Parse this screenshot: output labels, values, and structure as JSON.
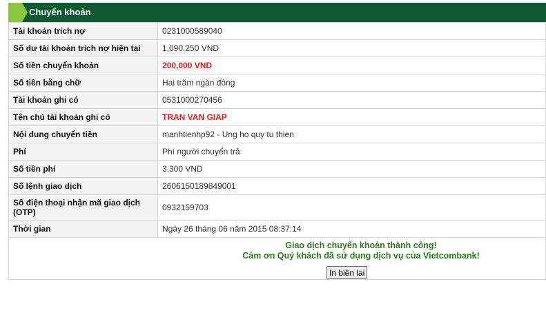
{
  "header": {
    "title": "Chuyển khoản"
  },
  "rows": [
    {
      "label": "Tài khoản trích nợ",
      "value": "0231000589040"
    },
    {
      "label": "Số dư tài khoản trích nợ hiện tại",
      "value": "1,090,250 VND"
    },
    {
      "label": "Số tiền chuyển khoản",
      "value": "200,000 VND"
    },
    {
      "label": "Số tiền bằng chữ",
      "value": "Hai trăm ngàn đồng"
    },
    {
      "label": "Tài khoản ghi có",
      "value": "0531000270456"
    },
    {
      "label": "Tên chủ tài khoản ghi có",
      "value": "TRAN VAN GIAP"
    },
    {
      "label": "Nội dung chuyển tiền",
      "value": "manhtienhp92 - Ung ho quy tu thien"
    },
    {
      "label": "Phí",
      "value": "Phí người chuyển trả"
    },
    {
      "label": "Số tiền phí",
      "value": "3,300 VND"
    },
    {
      "label": "Số lệnh giao dịch",
      "value": "2606150189849001"
    },
    {
      "label": "Số điện thoại nhận mã giao dịch (OTP)",
      "value": "0932159703"
    },
    {
      "label": "Thời gian",
      "value": "Ngày 26 tháng 06 năm 2015 08:37:14"
    }
  ],
  "footer": {
    "success_message": "Giao dịch chuyển khoản thành công!",
    "thanks_message": "Cảm ơn Quý khách đã sử dụng dịch vụ của Vietcombank!",
    "print_button": "In biên lai"
  },
  "colors": {
    "header_bg": "#0d5a32",
    "header_accent": "#8cc63f",
    "highlight_text": "#e01e1e",
    "success_text": "#2a7d1c"
  }
}
